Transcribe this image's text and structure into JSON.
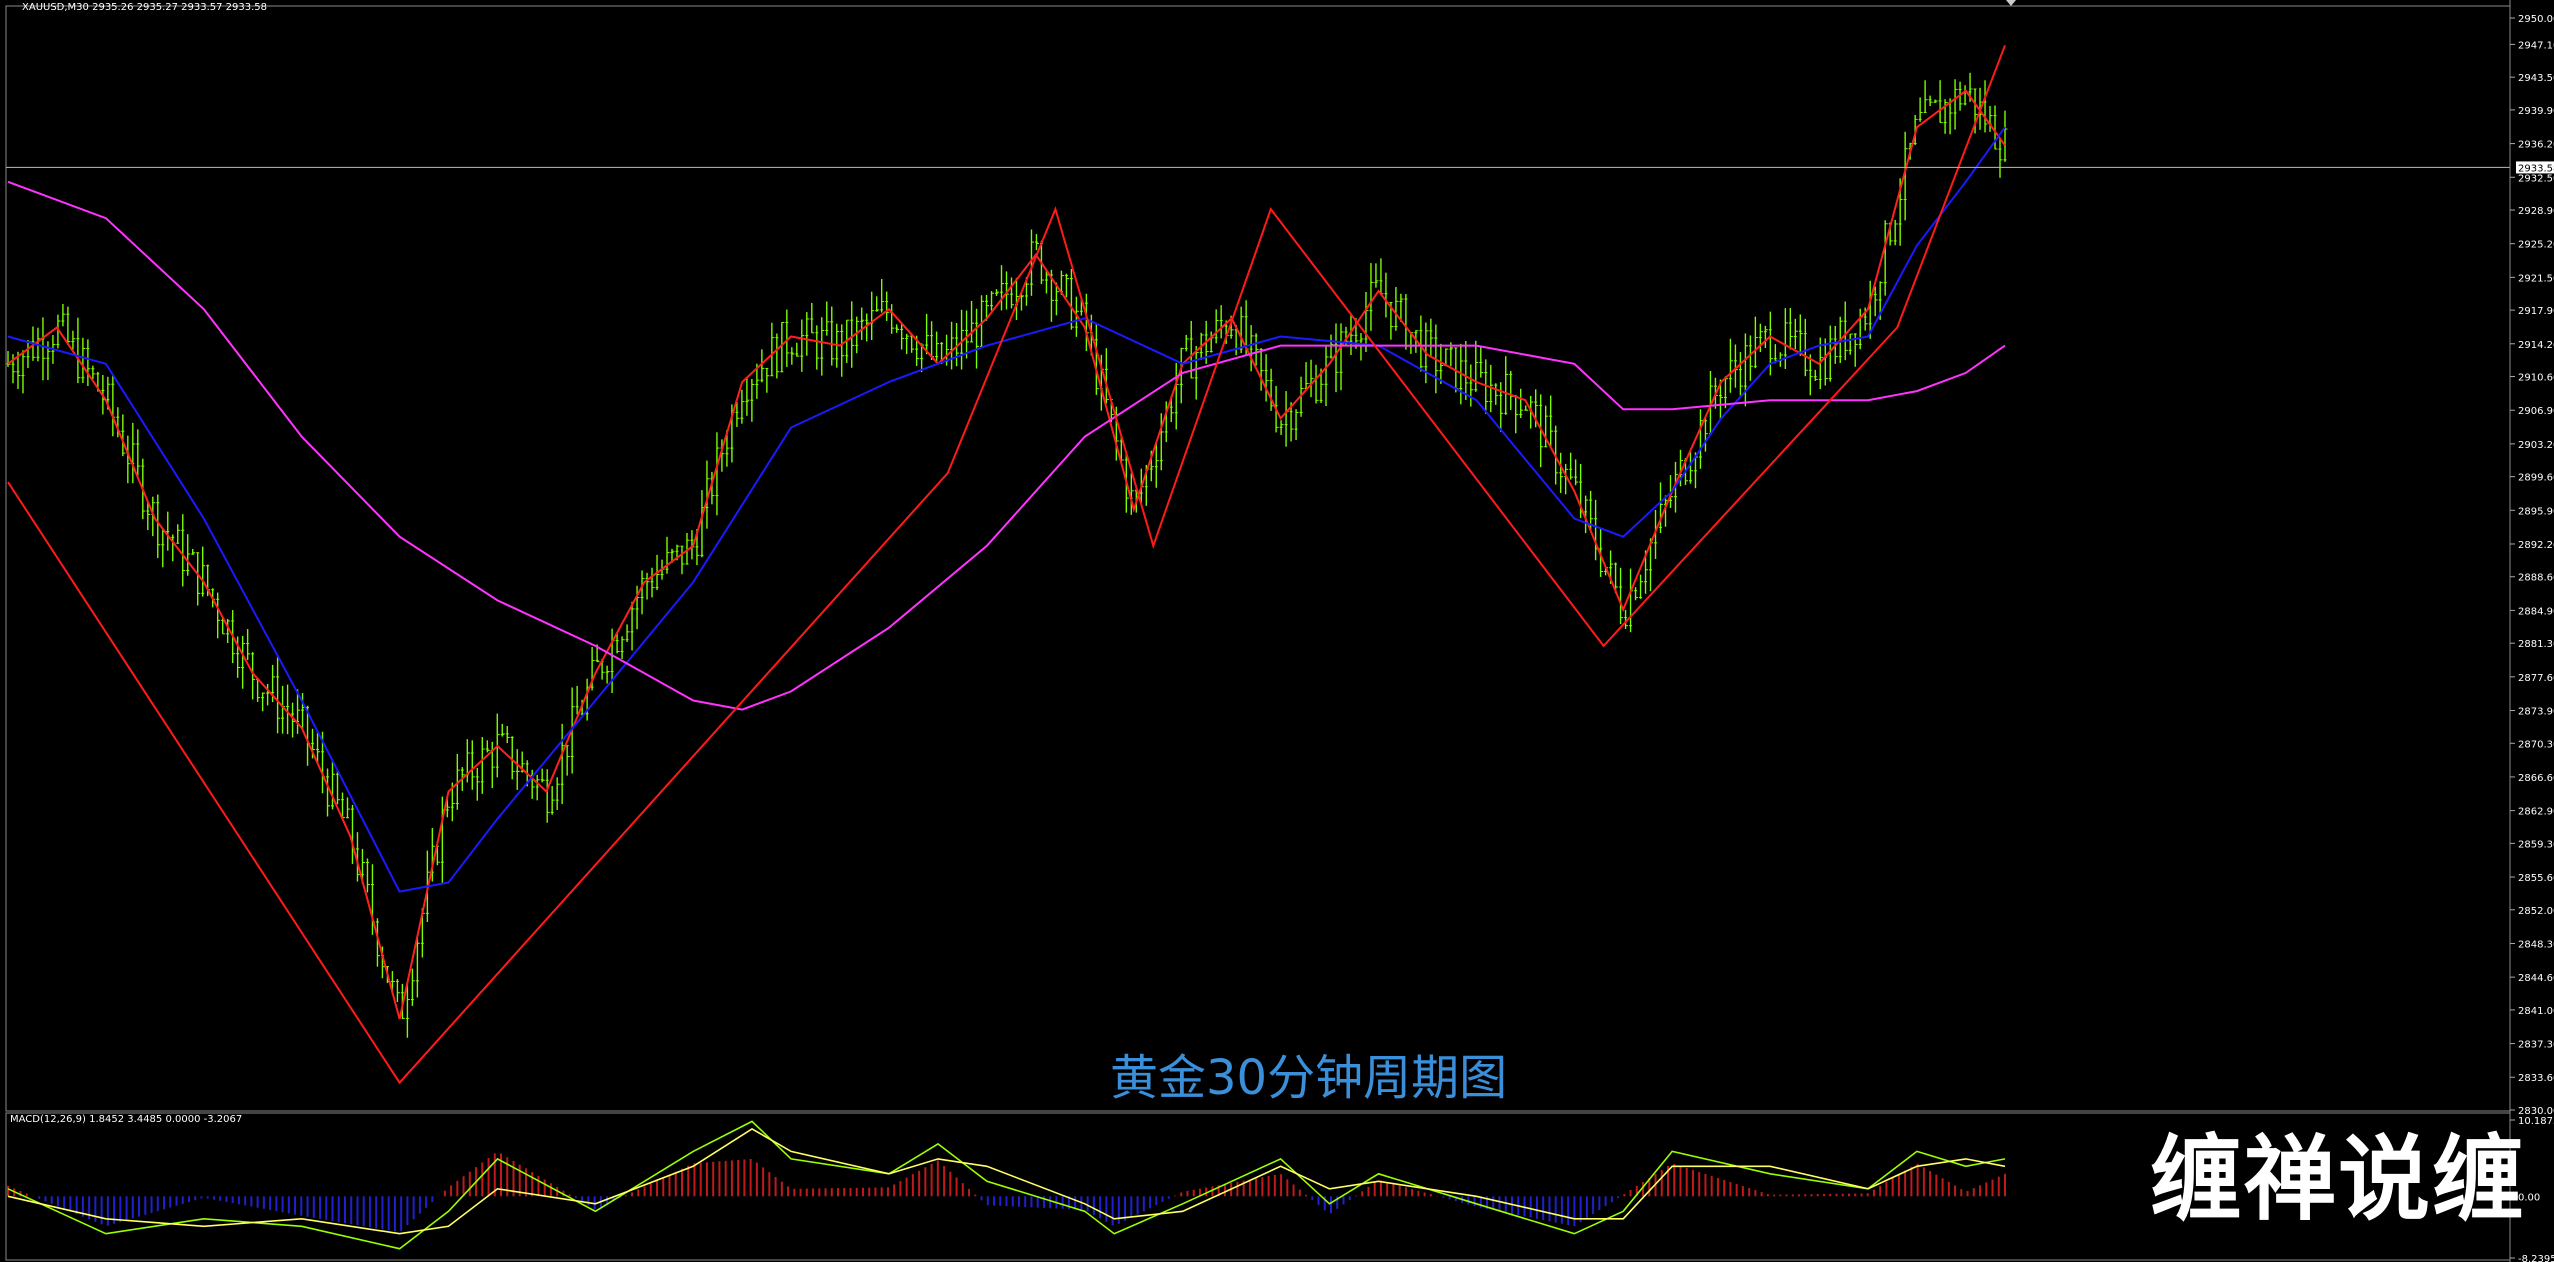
{
  "header": {
    "symbol_line": "XAUUSD,M30  2935.26 2935.27 2933.57 2933.58"
  },
  "caption": "黄金30分钟周期图",
  "watermark": "缠禅说缠",
  "macd": {
    "label": "MACD(12,26,9) 1.8452 3.4485 0.0000 -3.2067",
    "ticks": [
      "10.1873",
      "0.00",
      "-8.2395"
    ]
  },
  "current_price": "2933.58",
  "colors": {
    "candle": "#7cfc00",
    "ma_fast": "#ff2020",
    "ma_mid": "#1a1aff",
    "ma_slow": "#ff33ff",
    "zigzag": "#ff1a1a",
    "macd_pos": "#c01a1a",
    "macd_neg": "#2020d0",
    "macd_line": "#9aff00",
    "signal_line": "#ffff66"
  },
  "chart_data": {
    "type": "line",
    "title": "",
    "ylim": [
      2830.0,
      2950.0
    ],
    "y_ticks": [
      "2950.00",
      "2947.10",
      "2943.50",
      "2939.90",
      "2936.20",
      "2932.50",
      "2928.90",
      "2925.20",
      "2921.50",
      "2917.90",
      "2914.20",
      "2910.60",
      "2906.90",
      "2903.20",
      "2899.60",
      "2895.90",
      "2892.20",
      "2888.60",
      "2884.90",
      "2881.30",
      "2877.60",
      "2873.90",
      "2870.30",
      "2866.60",
      "2862.90",
      "2859.30",
      "2855.60",
      "2852.00",
      "2848.30",
      "2844.60",
      "2841.00",
      "2837.30",
      "2833.60",
      "2830.00"
    ],
    "series": [
      {
        "name": "zigzag",
        "x": [
          0,
          40,
          96,
          107,
          117,
          129,
          163,
          193,
          204
        ],
        "y": [
          2899,
          2833,
          2900,
          2929,
          2892,
          2929,
          2881,
          2916,
          2947
        ]
      },
      {
        "name": "price",
        "x": [
          0,
          5,
          10,
          15,
          20,
          25,
          30,
          35,
          40,
          45,
          50,
          55,
          60,
          65,
          70,
          75,
          80,
          85,
          90,
          95,
          100,
          105,
          110,
          115,
          120,
          125,
          130,
          135,
          140,
          145,
          150,
          155,
          160,
          165,
          170,
          175,
          180,
          185,
          190,
          195,
          200,
          204
        ],
        "y": [
          2912,
          2916,
          2908,
          2895,
          2888,
          2878,
          2872,
          2860,
          2840,
          2865,
          2870,
          2865,
          2878,
          2888,
          2892,
          2910,
          2915,
          2914,
          2918,
          2912,
          2917,
          2924,
          2916,
          2896,
          2912,
          2917,
          2906,
          2912,
          2920,
          2913,
          2910,
          2908,
          2898,
          2885,
          2898,
          2910,
          2915,
          2912,
          2918,
          2938,
          2942,
          2936
        ]
      },
      {
        "name": "ma_mid",
        "x": [
          0,
          10,
          20,
          30,
          40,
          45,
          50,
          60,
          70,
          80,
          90,
          100,
          110,
          120,
          130,
          140,
          150,
          160,
          165,
          170,
          175,
          180,
          185,
          190,
          195,
          200,
          204
        ],
        "y": [
          2915,
          2912,
          2895,
          2875,
          2854,
          2855,
          2862,
          2875,
          2888,
          2905,
          2910,
          2914,
          2917,
          2912,
          2915,
          2914,
          2908,
          2895,
          2893,
          2898,
          2906,
          2912,
          2914,
          2915,
          2925,
          2932,
          2938
        ]
      },
      {
        "name": "ma_slow",
        "x": [
          0,
          10,
          20,
          30,
          40,
          50,
          60,
          70,
          75,
          80,
          90,
          100,
          110,
          120,
          130,
          140,
          150,
          160,
          165,
          170,
          180,
          190,
          195,
          200,
          204
        ],
        "y": [
          2932,
          2928,
          2918,
          2904,
          2893,
          2886,
          2881,
          2875,
          2874,
          2876,
          2883,
          2892,
          2904,
          2911,
          2914,
          2914,
          2914,
          2912,
          2907,
          2907,
          2908,
          2908,
          2909,
          2911,
          2914
        ]
      },
      {
        "name": "macd_line",
        "x": [
          0,
          10,
          20,
          30,
          40,
          45,
          50,
          60,
          70,
          76,
          80,
          90,
          95,
          100,
          110,
          113,
          120,
          130,
          135,
          140,
          150,
          160,
          165,
          170,
          180,
          190,
          195,
          200,
          204
        ],
        "y": [
          1,
          -5,
          -3,
          -4,
          -7,
          -2,
          5,
          -2,
          6,
          10,
          5,
          3,
          7,
          2,
          -2,
          -5,
          -1,
          5,
          -1,
          3,
          -1,
          -5,
          -2,
          6,
          3,
          1,
          6,
          4,
          5
        ]
      },
      {
        "name": "signal_line",
        "x": [
          0,
          10,
          20,
          30,
          40,
          45,
          50,
          60,
          70,
          76,
          80,
          90,
          95,
          100,
          110,
          113,
          120,
          130,
          135,
          140,
          150,
          160,
          165,
          170,
          180,
          190,
          195,
          200,
          204
        ],
        "y": [
          0,
          -3,
          -4,
          -3,
          -5,
          -4,
          1,
          -1,
          4,
          9,
          6,
          3,
          5,
          4,
          -1,
          -3,
          -2,
          4,
          1,
          2,
          0,
          -3,
          -3,
          4,
          4,
          1,
          4,
          5,
          4
        ]
      }
    ]
  }
}
